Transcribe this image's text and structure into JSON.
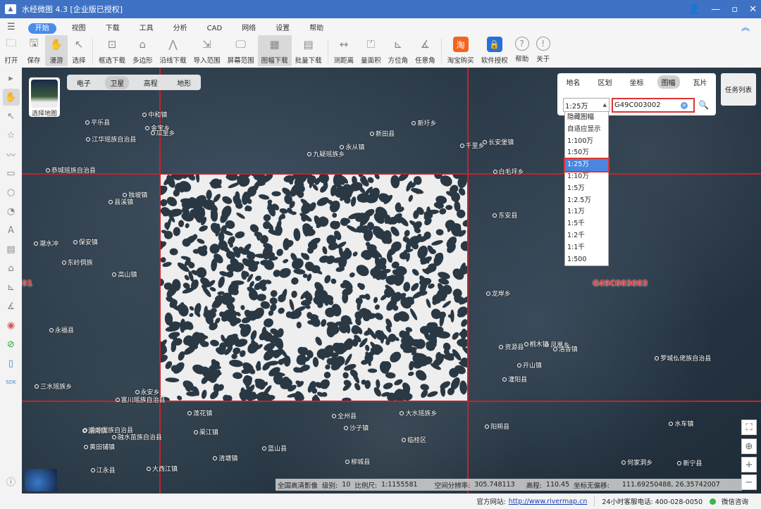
{
  "window": {
    "title": "水经微图 4.3 [企业版已授权]"
  },
  "menu": {
    "items": [
      "开始",
      "视图",
      "下载",
      "工具",
      "分析",
      "CAD",
      "网络",
      "设置",
      "帮助"
    ]
  },
  "toolbar": {
    "items": [
      {
        "label": "打开",
        "icon": "folder-icon"
      },
      {
        "label": "保存",
        "icon": "save-icon"
      },
      {
        "label": "漫游",
        "icon": "hand-icon"
      },
      {
        "label": "选择",
        "icon": "cursor-icon"
      },
      {
        "label": "框选下载",
        "icon": "box-download-icon"
      },
      {
        "label": "多边形",
        "icon": "polygon-download-icon"
      },
      {
        "label": "沿线下载",
        "icon": "line-download-icon"
      },
      {
        "label": "导入范围",
        "icon": "import-icon"
      },
      {
        "label": "屏幕范围",
        "icon": "screen-icon"
      },
      {
        "label": "图幅下载",
        "icon": "sheet-download-icon"
      },
      {
        "label": "批量下载",
        "icon": "batch-download-icon"
      },
      {
        "label": "测距离",
        "icon": "ruler-icon"
      },
      {
        "label": "量面积",
        "icon": "area-icon"
      },
      {
        "label": "方位角",
        "icon": "azimuth-icon"
      },
      {
        "label": "任意角",
        "icon": "angle-icon"
      },
      {
        "label": "淘宝购买",
        "icon": "taobao-icon"
      },
      {
        "label": "软件授权",
        "icon": "license-icon"
      },
      {
        "label": "帮助",
        "icon": "help-icon"
      },
      {
        "label": "关于",
        "icon": "info-icon"
      }
    ]
  },
  "map": {
    "basemap_label": "选择地图",
    "map_types": [
      "电子",
      "卫星",
      "高程",
      "地形"
    ],
    "map_type_active": "卫星",
    "places": [
      "县溪镇",
      "通道侗族自治县",
      "长安堡镇",
      "白毛坪乡",
      "瓜里乡",
      "新宁县",
      "高山镇",
      "东安县",
      "大西江镇",
      "永安乡",
      "黄田铺镇",
      "渠江镇",
      "洛香镇",
      "独坡镇",
      "永从镇",
      "东岭侗族",
      "资源县",
      "全州县",
      "何家洞乡",
      "水车镇",
      "凤凰乡",
      "新圩乡",
      "灌阳县",
      "清塘镇",
      "潮水冲",
      "江永县",
      "沙子镇",
      "富川瑶族自治县",
      "恭城瑶族自治县",
      "开山镇",
      "阳朔县",
      "莲花镇",
      "金宝乡",
      "平乐县",
      "大水瑶族乡",
      "新田县",
      "保安镇",
      "中和镇",
      "千里乡",
      "九疑瑶族乡",
      "三水瑶族乡",
      "蓝山县",
      "桐木镇",
      "湄南镇",
      "江华瑶族自治县",
      "永福县",
      "临桂区",
      "融水苗族自治县",
      "龙岸乡",
      "罗城仫佬族自治县",
      "柳城县"
    ],
    "sheet_labels": [
      "G49C003003",
      "01"
    ],
    "grid_color": "#c8202a"
  },
  "search": {
    "tabs": [
      "地名",
      "区划",
      "坐标",
      "图幅",
      "瓦片"
    ],
    "active_tab": "图幅",
    "scale_value": "1:25万",
    "sheet_value": "G49C003002",
    "scale_options": [
      "隐藏图幅",
      "自适应显示",
      "1:100万",
      "1:50万",
      "1:25万",
      "1:10万",
      "1:5万",
      "1:2.5万",
      "1:1万",
      "1:5千",
      "1:2千",
      "1:1千",
      "1:500"
    ],
    "selected_option": "1:25万"
  },
  "task_list": "任务列表",
  "status": {
    "source": "全国高清影像",
    "level_label": "级别:",
    "level": "10",
    "scale_label": "比例尺:",
    "scale": "1:1155581",
    "res_label": "空间分辨率:",
    "res": "305.748113",
    "elev_label": "高程:",
    "elev": "110.45",
    "coord_label": "坐标无偏移:",
    "coord": "111.69250488, 26.35742007"
  },
  "footer": {
    "site_label": "官方网站:",
    "site": "http://www.rivermap.cn",
    "phone": "24小时客服电话: 400-028-0050",
    "wechat": "微信咨询"
  },
  "colors": {
    "titlebar": "#3f72c4",
    "accent": "#4a8de8",
    "highlight": "#d33333"
  }
}
